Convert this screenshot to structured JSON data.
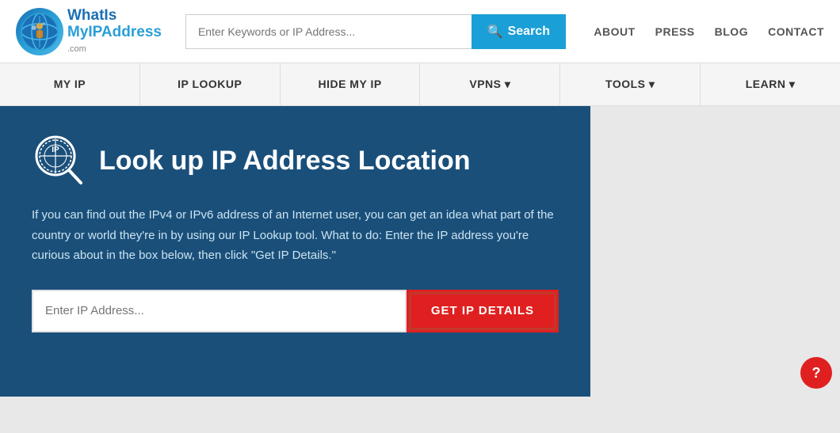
{
  "header": {
    "logo": {
      "text_what": "WhatIs",
      "text_my": "My",
      "text_ip": "IP",
      "text_address": "Address",
      "text_com": ".com"
    },
    "search": {
      "placeholder": "Enter Keywords or IP Address...",
      "button_label": "Search"
    },
    "nav_links": [
      {
        "label": "ABOUT"
      },
      {
        "label": "PRESS"
      },
      {
        "label": "BLOG"
      },
      {
        "label": "CONTACT"
      }
    ]
  },
  "navbar": {
    "items": [
      {
        "label": "MY IP"
      },
      {
        "label": "IP LOOKUP"
      },
      {
        "label": "HIDE MY IP"
      },
      {
        "label": "VPNS ▾"
      },
      {
        "label": "TOOLS ▾"
      },
      {
        "label": "LEARN ▾"
      }
    ]
  },
  "main": {
    "title": "Look up IP Address Location",
    "description": "If you can find out the IPv4 or IPv6 address of an Internet user, you can get an idea what part of the country or world they're in by using our IP Lookup tool. What to do: Enter the IP address you're curious about in the box below, then click \"Get IP Details.\"",
    "input_placeholder": "Enter IP Address...",
    "button_label": "GET IP DETAILS"
  },
  "icons": {
    "search": "🔍",
    "ip_magnify": "ip-magnify"
  }
}
